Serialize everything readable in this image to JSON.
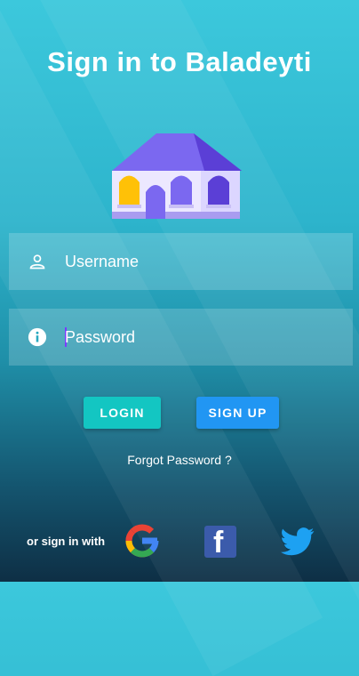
{
  "title": "Sign in to Baladeyti",
  "form": {
    "username_placeholder": "Username",
    "password_placeholder": "Password"
  },
  "buttons": {
    "login": "LOGIN",
    "signup": "SIGN UP"
  },
  "forgot_password": "Forgot Password ?",
  "social": {
    "label": "or sign in with",
    "providers": [
      "google-icon",
      "facebook-icon",
      "twitter-icon"
    ]
  },
  "colors": {
    "login_button": "#13c6c2",
    "signup_button": "#2196f3",
    "house_roof": "#5b3fd6",
    "house_wall": "#ece8ff"
  },
  "icons": {
    "username": "person-icon",
    "password": "info-icon"
  }
}
